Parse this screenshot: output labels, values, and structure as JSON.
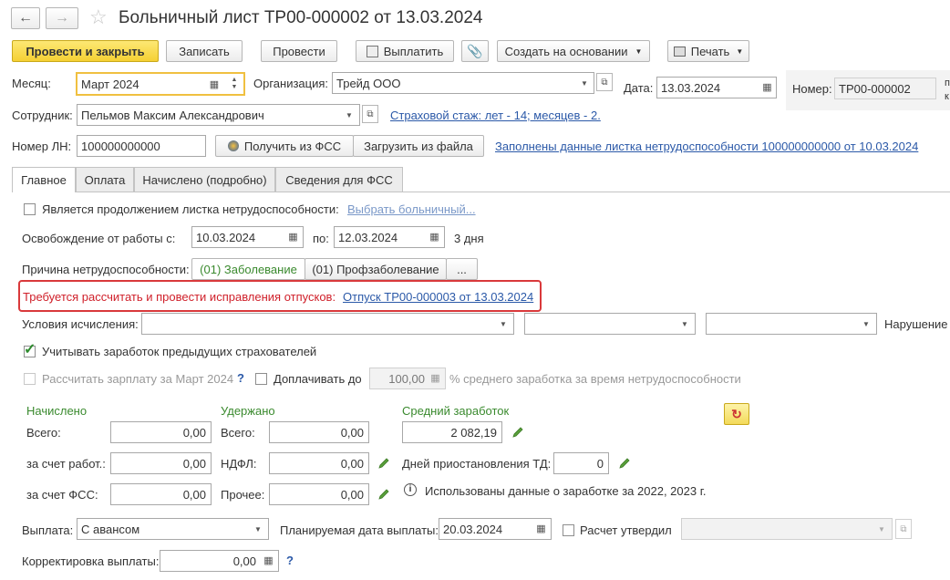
{
  "window": {
    "title": "Больничный лист ТР00-000002 от 13.03.2024"
  },
  "toolbar": {
    "post_close": "Провести и закрыть",
    "save": "Записать",
    "post": "Провести",
    "pay": "Выплатить",
    "create_based": "Создать на основании",
    "print": "Печать"
  },
  "header": {
    "month_label": "Месяц:",
    "month_value": "Март 2024",
    "org_label": "Организация:",
    "org_value": "Трейд ООО",
    "date_label": "Дата:",
    "date_value": "13.03.2024",
    "number_label": "Номер:",
    "number_value": "ТР00-000002",
    "employee_label": "Сотрудник:",
    "employee_value": "Пельмов Максим Александрович",
    "insurance_link": "Страховой стаж: лет - 14; месяцев - 2.",
    "ln_label": "Номер ЛН:",
    "ln_value": "100000000000",
    "get_fss": "Получить из ФСС",
    "load_file": "Загрузить из файла",
    "filled_link": "Заполнены данные листка нетрудоспособности 100000000000 от 10.03.2024"
  },
  "tabs": [
    "Главное",
    "Оплата",
    "Начислено (подробно)",
    "Сведения для ФСС"
  ],
  "main": {
    "continuation_label": "Является продолжением листка нетрудоспособности:",
    "choose_sick": "Выбрать больничный...",
    "release_label": "Освобождение от работы с:",
    "release_from": "10.03.2024",
    "release_to_label": "по:",
    "release_to": "12.03.2024",
    "days": "3 дня",
    "reason_label": "Причина нетрудоспособности:",
    "reason_1": "(01) Заболевание",
    "reason_2": "(01) Профзаболевание",
    "reason_more": "...",
    "warning_text": "Требуется рассчитать и провести исправления отпусков:",
    "warning_link": "Отпуск ТР00-000003 от 13.03.2024",
    "conditions_label": "Условия исчисления:",
    "violation_label": "Нарушение",
    "prev_insurers_label": "Учитывать заработок предыдущих страхователей",
    "calc_salary_label": "Рассчитать зарплату за Март 2024",
    "help_mark": "?",
    "pay_up_to_label": "Доплачивать до",
    "pay_up_to_value": "100,00",
    "avg_earnings_text": "% среднего заработка за время нетрудоспособности"
  },
  "totals": {
    "accrued_header": "Начислено",
    "withheld_header": "Удержано",
    "avg_header": "Средний заработок",
    "total_label": "Всего:",
    "accrued_total": "0,00",
    "employer_label": "за счет работ.:",
    "employer_value": "0,00",
    "fss_label": "за счет ФСС:",
    "fss_value": "0,00",
    "withheld_total_label": "Всего:",
    "withheld_total": "0,00",
    "ndfl_label": "НДФЛ:",
    "ndfl_value": "0,00",
    "other_label": "Прочее:",
    "other_value": "0,00",
    "avg_value": "2 082,19",
    "suspension_label": "Дней приостановления ТД:",
    "suspension_value": "0",
    "info_text": "Использованы данные о заработке за  2022,  2023 г."
  },
  "payment": {
    "payout_label": "Выплата:",
    "payout_value": "С авансом",
    "planned_date_label": "Планируемая дата выплаты:",
    "planned_date_value": "20.03.2024",
    "approved_label": "Расчет утвердил",
    "correction_label": "Корректировка выплаты:",
    "correction_value": "0,00",
    "help_mark": "?"
  },
  "right_edge": {
    "line1": "п",
    "line2": "к"
  }
}
